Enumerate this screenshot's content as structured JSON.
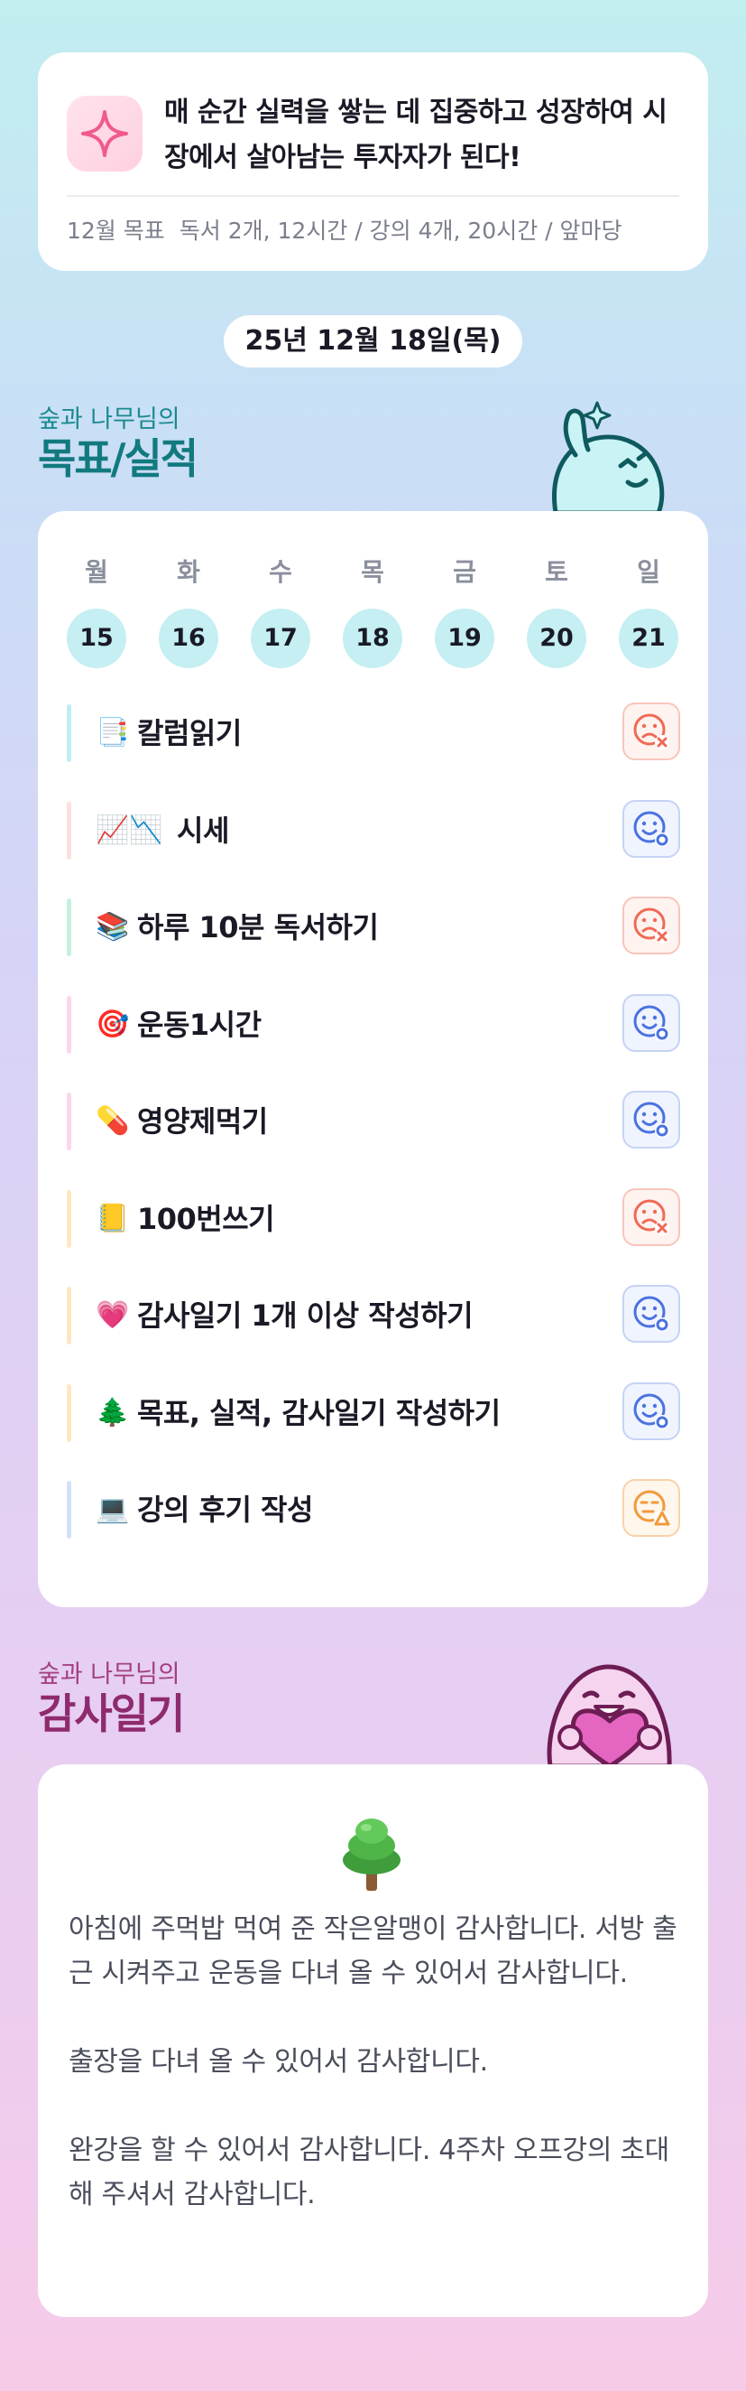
{
  "quote": {
    "text": "매 순간 실력을 쌓는 데 집중하고 성장하여 시장에서 살아남는 투자자가 된다!",
    "goal_label": "12월 목표",
    "goal_text": "독서 2개, 12시간 / 강의 4개, 20시간 / 앞마당"
  },
  "date": "25년 12월 18일(목)",
  "goals_section": {
    "subtitle": "숲과 나무님의",
    "title": "목표/실적"
  },
  "week": {
    "days": [
      "월",
      "화",
      "수",
      "목",
      "금",
      "토",
      "일"
    ],
    "dates": [
      "15",
      "16",
      "17",
      "18",
      "19",
      "20",
      "21"
    ]
  },
  "goals": [
    {
      "emoji": "📑",
      "label": "칼럼읽기",
      "status": "fail",
      "bar_color": "#bfeef2"
    },
    {
      "emoji": "📈📉",
      "label": "시세",
      "status": "done",
      "bar_color": "#fde0dc"
    },
    {
      "emoji": "📚",
      "label": "하루 10분 독서하기",
      "status": "fail",
      "bar_color": "#c4f1dc"
    },
    {
      "emoji": "🎯",
      "label": "운동1시간",
      "status": "done",
      "bar_color": "#fcd5ee"
    },
    {
      "emoji": "💊",
      "label": "영양제먹기",
      "status": "done",
      "bar_color": "#fcd5ee"
    },
    {
      "emoji": "📒",
      "label": "100번쓰기",
      "status": "fail",
      "bar_color": "#fde7c3"
    },
    {
      "emoji": "💗",
      "label": "감사일기 1개 이상 작성하기",
      "status": "done",
      "bar_color": "#fde7c3"
    },
    {
      "emoji": "🌲",
      "label": "목표, 실적, 감사일기 작성하기",
      "status": "done",
      "bar_color": "#fde7c3"
    },
    {
      "emoji": "💻",
      "label": "강의 후기 작성",
      "status": "partial",
      "bar_color": "#d3e1f7"
    }
  ],
  "gratitude_section": {
    "subtitle": "숲과 나무님의",
    "title": "감사일기"
  },
  "gratitude": {
    "paragraphs": [
      "아침에 주먹밥 먹여 준 작은알맹이 감사합니다. 서방 출근 시켜주고 운동을 다녀 올 수 있어서 감사합니다.",
      "출장을 다녀 올 수 있어서 감사합니다.",
      "완강을 할 수 있어서 감사합니다. 4주차 오프강의 초대 해 주셔서 감사합니다."
    ]
  },
  "colors": {
    "fail": "#ef6a55",
    "done": "#4a72e0",
    "partial": "#f29a3a",
    "goals_title": "#127a7f",
    "gratitude_title": "#8e2a6d"
  },
  "icons": {
    "quote": "sparkle-icon",
    "fail": "sad-face-x-icon",
    "done": "smile-face-check-icon",
    "partial": "neutral-face-warning-icon",
    "gratitude": "tree-icon"
  }
}
